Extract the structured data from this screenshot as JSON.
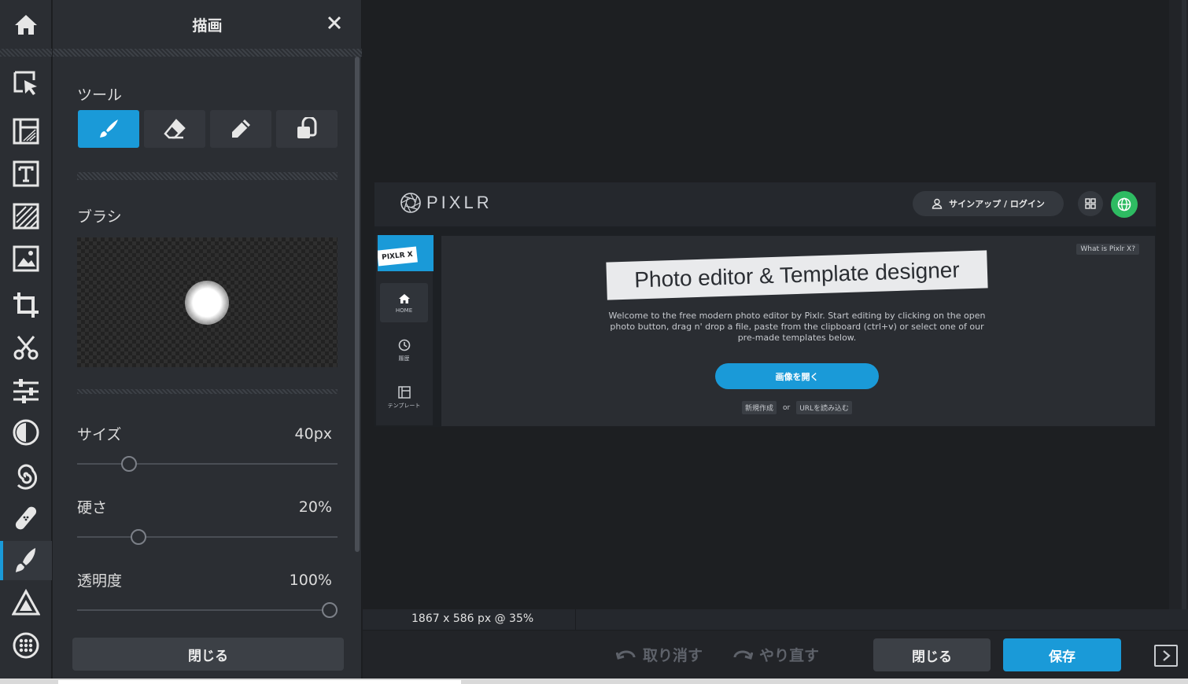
{
  "toolbar": {
    "home_icon": "home-icon",
    "tools": [
      {
        "name": "arrange",
        "icon": "cursor-select-icon"
      },
      {
        "name": "layout",
        "icon": "layout-template-icon"
      },
      {
        "name": "text",
        "icon": "text-icon"
      },
      {
        "name": "pattern",
        "icon": "hatch-pattern-icon"
      },
      {
        "name": "image",
        "icon": "image-icon"
      },
      {
        "name": "crop",
        "icon": "crop-icon"
      },
      {
        "name": "cutout",
        "icon": "scissors-icon"
      },
      {
        "name": "adjust",
        "icon": "sliders-icon"
      },
      {
        "name": "filter",
        "icon": "contrast-icon"
      },
      {
        "name": "liquify",
        "icon": "spiral-icon"
      },
      {
        "name": "heal",
        "icon": "bandage-icon"
      },
      {
        "name": "draw",
        "icon": "brush-icon",
        "active": true
      },
      {
        "name": "shape",
        "icon": "triangle-shapes-icon"
      },
      {
        "name": "sticker",
        "icon": "pattern-circle-icon"
      }
    ]
  },
  "panel": {
    "title": "描画",
    "tools_label": "ツール",
    "tool_buttons": [
      {
        "icon": "paint-brush-icon",
        "active": true
      },
      {
        "icon": "eraser-icon",
        "active": false
      },
      {
        "icon": "pen-icon",
        "active": false
      },
      {
        "icon": "clone-stamp-icon",
        "active": false
      }
    ],
    "brush_label": "ブラシ",
    "size": {
      "label": "サイズ",
      "value": "40px",
      "fraction": 0.18
    },
    "hardness": {
      "label": "硬さ",
      "value": "20%",
      "fraction": 0.22
    },
    "opacity": {
      "label": "透明度",
      "value": "100%",
      "fraction": 1.0
    },
    "close_button": "閉じる"
  },
  "canvas": {
    "logo_text": "PIXLR",
    "login_button": "サインアップ / ログイン",
    "pixlr_x_label": "PIXLR X",
    "nav": [
      {
        "label": "HOME",
        "icon": "home-icon"
      },
      {
        "label": "履歴",
        "icon": "history-icon"
      },
      {
        "label": "テンプレート",
        "icon": "template-icon"
      }
    ],
    "what_is": "What is Pixlr X?",
    "hero_title": "Photo editor & Template designer",
    "description": "Welcome to the free modern photo editor by Pixlr. Start editing by clicking on the open photo button, drag n' drop a file, paste from the clipboard (ctrl+v) or select one of our pre-made templates below.",
    "open_button": "画像を開く",
    "new_link": "新規作成",
    "or_text": "or",
    "url_link": "URLを読み込む"
  },
  "status": {
    "dimensions": "1867 x 586 px @ 35%"
  },
  "bottom": {
    "undo": "取り消す",
    "redo": "やり直す",
    "close": "閉じる",
    "save": "保存"
  },
  "colors": {
    "accent": "#1a9ad8",
    "globe": "#2ebb62"
  }
}
